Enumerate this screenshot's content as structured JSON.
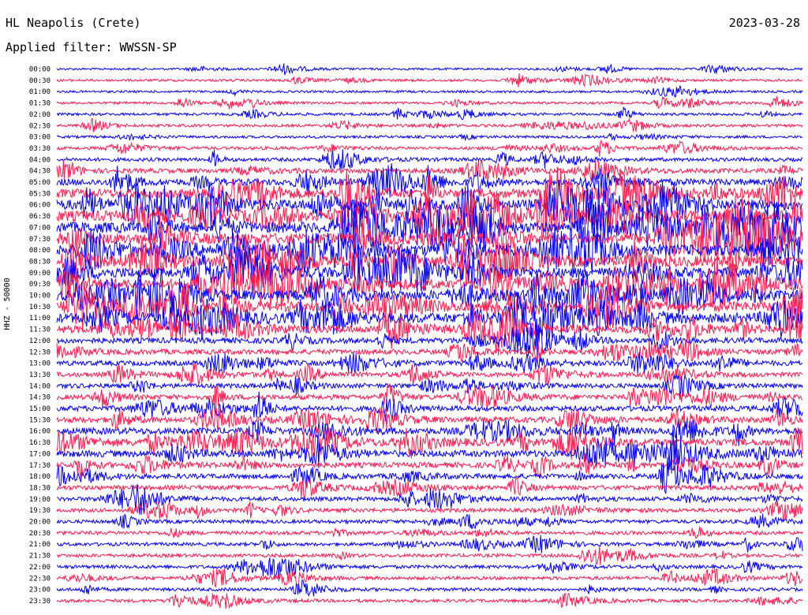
{
  "header": {
    "station": "HL Neapolis (Crete)",
    "filter": "Applied filter: WWSSN-SP",
    "date": "2023-03-28",
    "channel": "HHZ - 50000"
  },
  "chart_data": {
    "type": "line",
    "title": "HL Neapolis (Crete)",
    "subtitle": "Applied filter: WWSSN-SP",
    "ylabel": "HHZ - 50000",
    "date": "2023-03-28",
    "rows": [
      "00:00",
      "00:30",
      "01:00",
      "01:30",
      "02:00",
      "02:30",
      "03:00",
      "03:30",
      "04:00",
      "04:30",
      "05:00",
      "05:30",
      "06:00",
      "06:30",
      "07:00",
      "07:30",
      "08:00",
      "08:30",
      "09:00",
      "09:30",
      "10:00",
      "10:30",
      "11:00",
      "11:30",
      "12:00",
      "12:30",
      "13:00",
      "13:30",
      "14:00",
      "14:30",
      "15:00",
      "15:30",
      "16:00",
      "16:30",
      "17:00",
      "17:30",
      "18:00",
      "18:30",
      "19:00",
      "19:30",
      "20:00",
      "20:30",
      "21:00",
      "21:30",
      "22:00",
      "22:30",
      "23:00",
      "23:30"
    ],
    "colors": [
      "#0000ff",
      "#ff1a4d"
    ],
    "x_range_minutes": [
      0,
      30
    ],
    "grid": false,
    "row_activity": [
      0.08,
      0.12,
      0.1,
      0.12,
      0.14,
      0.15,
      0.14,
      0.18,
      0.25,
      0.35,
      0.55,
      0.8,
      0.95,
      1.0,
      1.0,
      1.0,
      1.0,
      0.95,
      0.95,
      0.9,
      0.9,
      0.9,
      0.9,
      0.7,
      0.45,
      0.4,
      0.38,
      0.36,
      0.36,
      0.38,
      0.42,
      0.46,
      0.55,
      0.62,
      0.55,
      0.42,
      0.38,
      0.34,
      0.3,
      0.28,
      0.24,
      0.24,
      0.22,
      0.22,
      0.22,
      0.22,
      0.2,
      0.2
    ]
  }
}
